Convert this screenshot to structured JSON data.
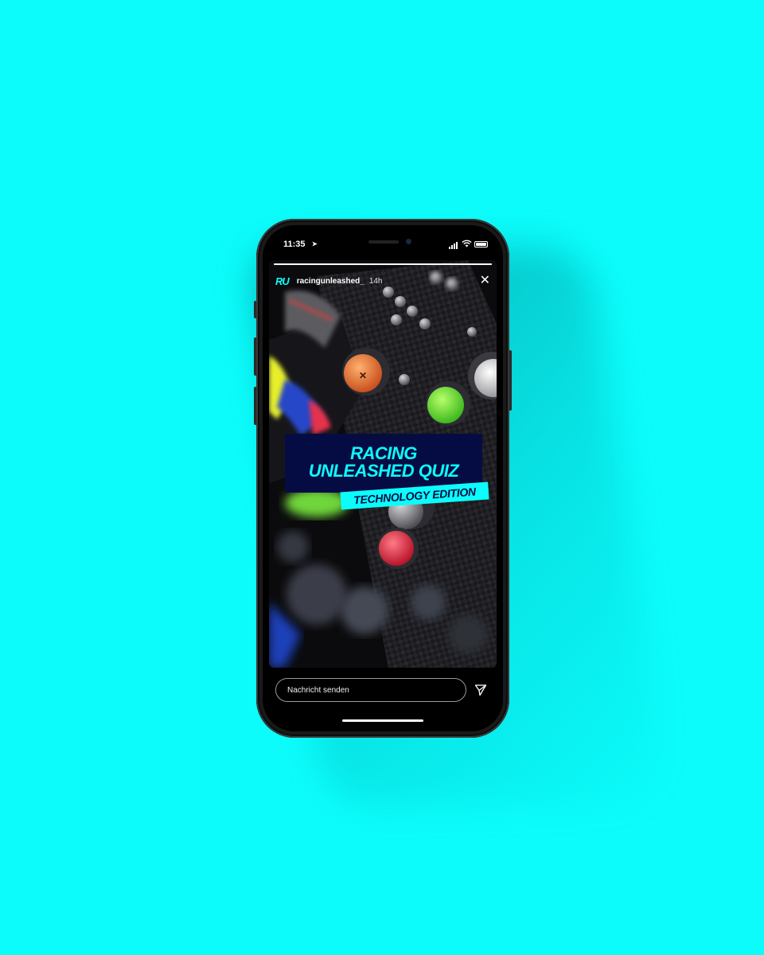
{
  "status_bar": {
    "time": "11:35"
  },
  "story": {
    "username": "racingunleashed_",
    "time_ago": "14h",
    "logo_text": "RU",
    "progress": 1.0,
    "title_line1": "RACING",
    "title_line2": "UNLEASHED QUIZ",
    "edition": "TECHNOLOGY EDITION"
  },
  "reply": {
    "placeholder": "Nachricht senden"
  },
  "colors": {
    "background": "#0bfcfb",
    "accent": "#0bfcfb",
    "title_box": "#050c44"
  }
}
